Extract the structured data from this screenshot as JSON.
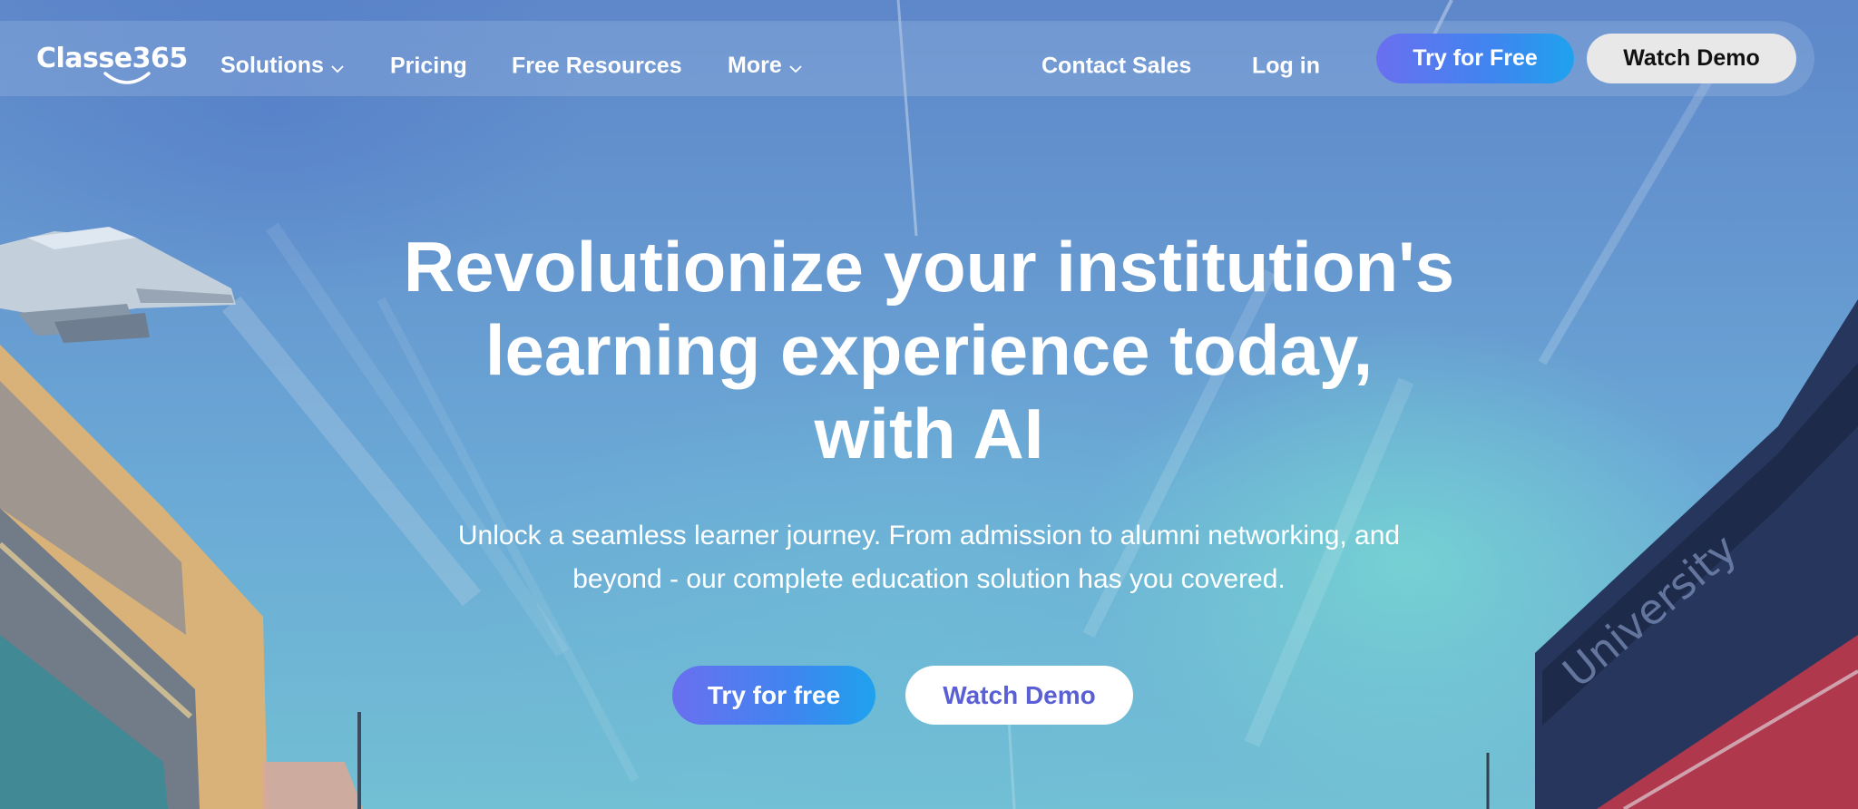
{
  "nav": {
    "logo_text": "Classe365",
    "items": [
      {
        "label": "Solutions",
        "has_dropdown": true
      },
      {
        "label": "Pricing",
        "has_dropdown": false
      },
      {
        "label": "Free Resources",
        "has_dropdown": false
      },
      {
        "label": "More",
        "has_dropdown": true
      }
    ],
    "contact_sales": "Contact Sales",
    "login": "Log in",
    "try_free": "Try for Free",
    "watch_demo": "Watch Demo"
  },
  "hero": {
    "headline_lines": [
      "Revolutionize your institution's",
      "learning experience today,",
      "with AI"
    ],
    "subtext_lines": [
      "Unlock a seamless learner journey. From admission to alumni networking, and",
      "beyond - our complete education solution has you covered."
    ],
    "primary_cta": "Try for free",
    "secondary_cta": "Watch Demo",
    "background_sign_text": "University"
  },
  "colors": {
    "cta_gradient_start": "#6a6ff0",
    "cta_gradient_end": "#1fa2ee",
    "secondary_cta_text": "#5b5fd6",
    "nav_demo_bg": "#e8e8e8"
  }
}
